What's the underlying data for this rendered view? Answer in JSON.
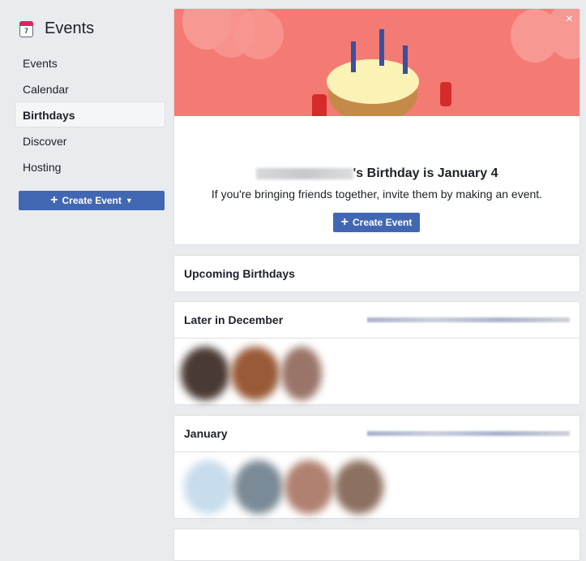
{
  "sidebar": {
    "title": "Events",
    "calendar_day": "7",
    "items": [
      "Events",
      "Calendar",
      "Birthdays",
      "Discover",
      "Hosting"
    ],
    "active": "Birthdays",
    "create_label": "Create Event"
  },
  "hero": {
    "close": "×",
    "title_suffix": "'s Birthday is January 4",
    "subtitle": "If you're bringing friends together, invite them by making an event.",
    "create_label": "Create Event"
  },
  "sections": {
    "upcoming": "Upcoming Birthdays",
    "later": "Later in December",
    "january": "January"
  },
  "colors": {
    "accent": "#4267b2",
    "banner": "#f37b74"
  }
}
